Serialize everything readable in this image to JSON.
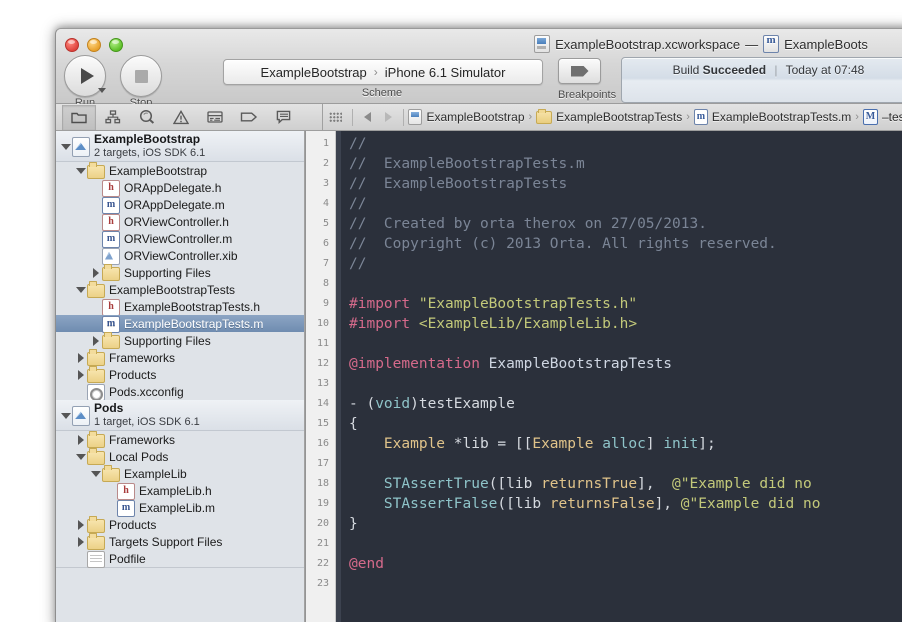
{
  "window": {
    "title_workspace": "ExampleBootstrap.xcworkspace",
    "title_dash": "—",
    "title_file": "ExampleBoots",
    "traffic": [
      "close-button",
      "minimize-button",
      "zoom-button"
    ]
  },
  "toolbar": {
    "run_label": "Run",
    "stop_label": "Stop",
    "scheme_project": "ExampleBootstrap",
    "scheme_separator": "›",
    "scheme_destination": "iPhone 6.1 Simulator",
    "scheme_caption": "Scheme",
    "breakpoints_caption": "Breakpoints",
    "status_prefix": "Build",
    "status_result": "Succeeded",
    "status_divider": "|",
    "status_time": "Today at 07:48"
  },
  "navigator_filterbar": {
    "icons": [
      "project-navigator-icon",
      "symbol-navigator-icon",
      "search-navigator-icon",
      "issue-navigator-icon",
      "test-navigator-icon",
      "debug-navigator-icon",
      "breakpoint-navigator-icon",
      "log-navigator-icon"
    ]
  },
  "jumpbar": {
    "grip": "grip-handle-icon",
    "back": "back-arrow-icon",
    "forward": "forward-arrow-icon",
    "crumbs": [
      {
        "label": "ExampleBootstrap",
        "icon": "project-icon"
      },
      {
        "label": "ExampleBootstrapTests",
        "icon": "folder-icon"
      },
      {
        "label": "ExampleBootstrapTests.m",
        "icon": "objc-implementation-icon"
      },
      {
        "label": "–testE",
        "icon": "method-marker-icon"
      }
    ],
    "separator": "›"
  },
  "navigator": {
    "rows": [
      {
        "id": "project-exampleBootstrap",
        "kind": "project",
        "name": "ExampleBootstrap",
        "sub": "2 targets, iOS SDK 6.1",
        "indent": 0,
        "disclosure": "open",
        "icon": "project-icon"
      },
      {
        "id": "group-exampleBootstrap",
        "kind": "folder",
        "name": "ExampleBootstrap",
        "indent": 1,
        "disclosure": "open",
        "icon": "folder-icon"
      },
      {
        "id": "file-orappdelegate-h",
        "kind": "file-h",
        "name": "ORAppDelegate.h",
        "indent": 2,
        "disclosure": "none",
        "icon": "header-file-icon"
      },
      {
        "id": "file-orappdelegate-m",
        "kind": "file-m",
        "name": "ORAppDelegate.m",
        "indent": 2,
        "disclosure": "none",
        "icon": "objc-implementation-icon"
      },
      {
        "id": "file-orviewcontroller-h",
        "kind": "file-h",
        "name": "ORViewController.h",
        "indent": 2,
        "disclosure": "none",
        "icon": "header-file-icon"
      },
      {
        "id": "file-orviewcontroller-m",
        "kind": "file-m",
        "name": "ORViewController.m",
        "indent": 2,
        "disclosure": "none",
        "icon": "objc-implementation-icon"
      },
      {
        "id": "file-orviewcontroller-xib",
        "kind": "file-xib",
        "name": "ORViewController.xib",
        "indent": 2,
        "disclosure": "none",
        "icon": "interface-builder-icon"
      },
      {
        "id": "group-supporting-files-1",
        "kind": "folder",
        "name": "Supporting Files",
        "indent": 2,
        "disclosure": "closed",
        "icon": "folder-icon"
      },
      {
        "id": "group-exampleBootstrapTests",
        "kind": "folder",
        "name": "ExampleBootstrapTests",
        "indent": 1,
        "disclosure": "open",
        "icon": "folder-icon"
      },
      {
        "id": "file-examplebootstraptests-h",
        "kind": "file-h",
        "name": "ExampleBootstrapTests.h",
        "indent": 2,
        "disclosure": "none",
        "icon": "header-file-icon"
      },
      {
        "id": "file-examplebootstraptests-m",
        "kind": "file-m",
        "name": "ExampleBootstrapTests.m",
        "indent": 2,
        "disclosure": "none",
        "icon": "objc-implementation-icon",
        "selected": true
      },
      {
        "id": "group-supporting-files-2",
        "kind": "folder",
        "name": "Supporting Files",
        "indent": 2,
        "disclosure": "closed",
        "icon": "folder-icon"
      },
      {
        "id": "group-frameworks-1",
        "kind": "folder",
        "name": "Frameworks",
        "indent": 1,
        "disclosure": "closed",
        "icon": "folder-icon"
      },
      {
        "id": "group-products-1",
        "kind": "folder",
        "name": "Products",
        "indent": 1,
        "disclosure": "closed",
        "icon": "folder-icon"
      },
      {
        "id": "file-pods-xcconfig",
        "kind": "file-cfg",
        "name": "Pods.xcconfig",
        "indent": 1,
        "disclosure": "none",
        "icon": "xcconfig-icon"
      },
      {
        "id": "project-pods",
        "kind": "project",
        "name": "Pods",
        "sub": "1 target, iOS SDK 6.1",
        "indent": 0,
        "disclosure": "open",
        "icon": "project-icon"
      },
      {
        "id": "group-frameworks-2",
        "kind": "folder",
        "name": "Frameworks",
        "indent": 1,
        "disclosure": "closed",
        "icon": "folder-icon"
      },
      {
        "id": "group-local-pods",
        "kind": "folder",
        "name": "Local Pods",
        "indent": 1,
        "disclosure": "open",
        "icon": "folder-icon"
      },
      {
        "id": "group-examplelib",
        "kind": "folder",
        "name": "ExampleLib",
        "indent": 2,
        "disclosure": "open",
        "icon": "folder-icon"
      },
      {
        "id": "file-examplelib-h",
        "kind": "file-h",
        "name": "ExampleLib.h",
        "indent": 3,
        "disclosure": "none",
        "icon": "header-file-icon"
      },
      {
        "id": "file-examplelib-m",
        "kind": "file-m",
        "name": "ExampleLib.m",
        "indent": 3,
        "disclosure": "none",
        "icon": "objc-implementation-icon"
      },
      {
        "id": "group-products-2",
        "kind": "folder",
        "name": "Products",
        "indent": 1,
        "disclosure": "closed",
        "icon": "folder-icon"
      },
      {
        "id": "group-targets-support-files",
        "kind": "folder",
        "name": "Targets Support Files",
        "indent": 1,
        "disclosure": "closed",
        "icon": "folder-icon"
      },
      {
        "id": "file-podfile",
        "kind": "file-plain",
        "name": "Podfile",
        "indent": 1,
        "disclosure": "none",
        "icon": "plain-file-icon"
      }
    ]
  },
  "editor": {
    "line_numbers": [
      1,
      2,
      3,
      4,
      5,
      6,
      7,
      8,
      9,
      10,
      11,
      12,
      13,
      14,
      15,
      16,
      17,
      18,
      19,
      20,
      21,
      22,
      23
    ],
    "lines": [
      [
        {
          "t": "//",
          "c": "comment"
        }
      ],
      [
        {
          "t": "//  ExampleBootstrapTests.m",
          "c": "comment"
        }
      ],
      [
        {
          "t": "//  ExampleBootstrapTests",
          "c": "comment"
        }
      ],
      [
        {
          "t": "//",
          "c": "comment"
        }
      ],
      [
        {
          "t": "//  Created by orta therox on 27/05/2013.",
          "c": "comment"
        }
      ],
      [
        {
          "t": "//  Copyright (c) 2013 Orta. All rights reserved.",
          "c": "comment"
        }
      ],
      [
        {
          "t": "//",
          "c": "comment"
        }
      ],
      [],
      [
        {
          "t": "#import ",
          "c": "pre"
        },
        {
          "t": "\"ExampleBootstrapTests.h\"",
          "c": "str"
        }
      ],
      [
        {
          "t": "#import ",
          "c": "pre"
        },
        {
          "t": "<ExampleLib/ExampleLib.h>",
          "c": "str"
        }
      ],
      [],
      [
        {
          "t": "@implementation",
          "c": "kw"
        },
        {
          "t": " ExampleBootstrapTests",
          "c": "cls"
        }
      ],
      [],
      [
        {
          "t": "- (",
          "c": "plain"
        },
        {
          "t": "void",
          "c": "msg"
        },
        {
          "t": ")testExample",
          "c": "plain"
        }
      ],
      [
        {
          "t": "{",
          "c": "plain"
        }
      ],
      [
        {
          "t": "    ",
          "c": "plain"
        },
        {
          "t": "Example",
          "c": "type"
        },
        {
          "t": " *lib = [[",
          "c": "plain"
        },
        {
          "t": "Example",
          "c": "type"
        },
        {
          "t": " ",
          "c": "plain"
        },
        {
          "t": "alloc",
          "c": "msg"
        },
        {
          "t": "] ",
          "c": "plain"
        },
        {
          "t": "init",
          "c": "msg"
        },
        {
          "t": "];",
          "c": "plain"
        }
      ],
      [],
      [
        {
          "t": "    ",
          "c": "plain"
        },
        {
          "t": "STAssertTrue",
          "c": "msg"
        },
        {
          "t": "([lib ",
          "c": "plain"
        },
        {
          "t": "returnsTrue",
          "c": "type"
        },
        {
          "t": "],  ",
          "c": "plain"
        },
        {
          "t": "@\"Example did no",
          "c": "str"
        }
      ],
      [
        {
          "t": "    ",
          "c": "plain"
        },
        {
          "t": "STAssertFalse",
          "c": "msg"
        },
        {
          "t": "([lib ",
          "c": "plain"
        },
        {
          "t": "returnsFalse",
          "c": "type"
        },
        {
          "t": "], ",
          "c": "plain"
        },
        {
          "t": "@\"Example did no",
          "c": "str"
        }
      ],
      [
        {
          "t": "}",
          "c": "plain"
        }
      ],
      [],
      [
        {
          "t": "@end",
          "c": "kw"
        }
      ],
      []
    ]
  },
  "colors": {
    "editor_background": "#2b303b",
    "gutter_background": "#f0f0f0",
    "navigator_background": "#dfe3e8",
    "selection_blue": "#7d98bd",
    "comment": "#7b8596",
    "preprocessor": "#d56a8b",
    "string": "#c3c97a",
    "type": "#e0c38a",
    "message": "#8fc4c9",
    "plain": "#d6dae0"
  }
}
